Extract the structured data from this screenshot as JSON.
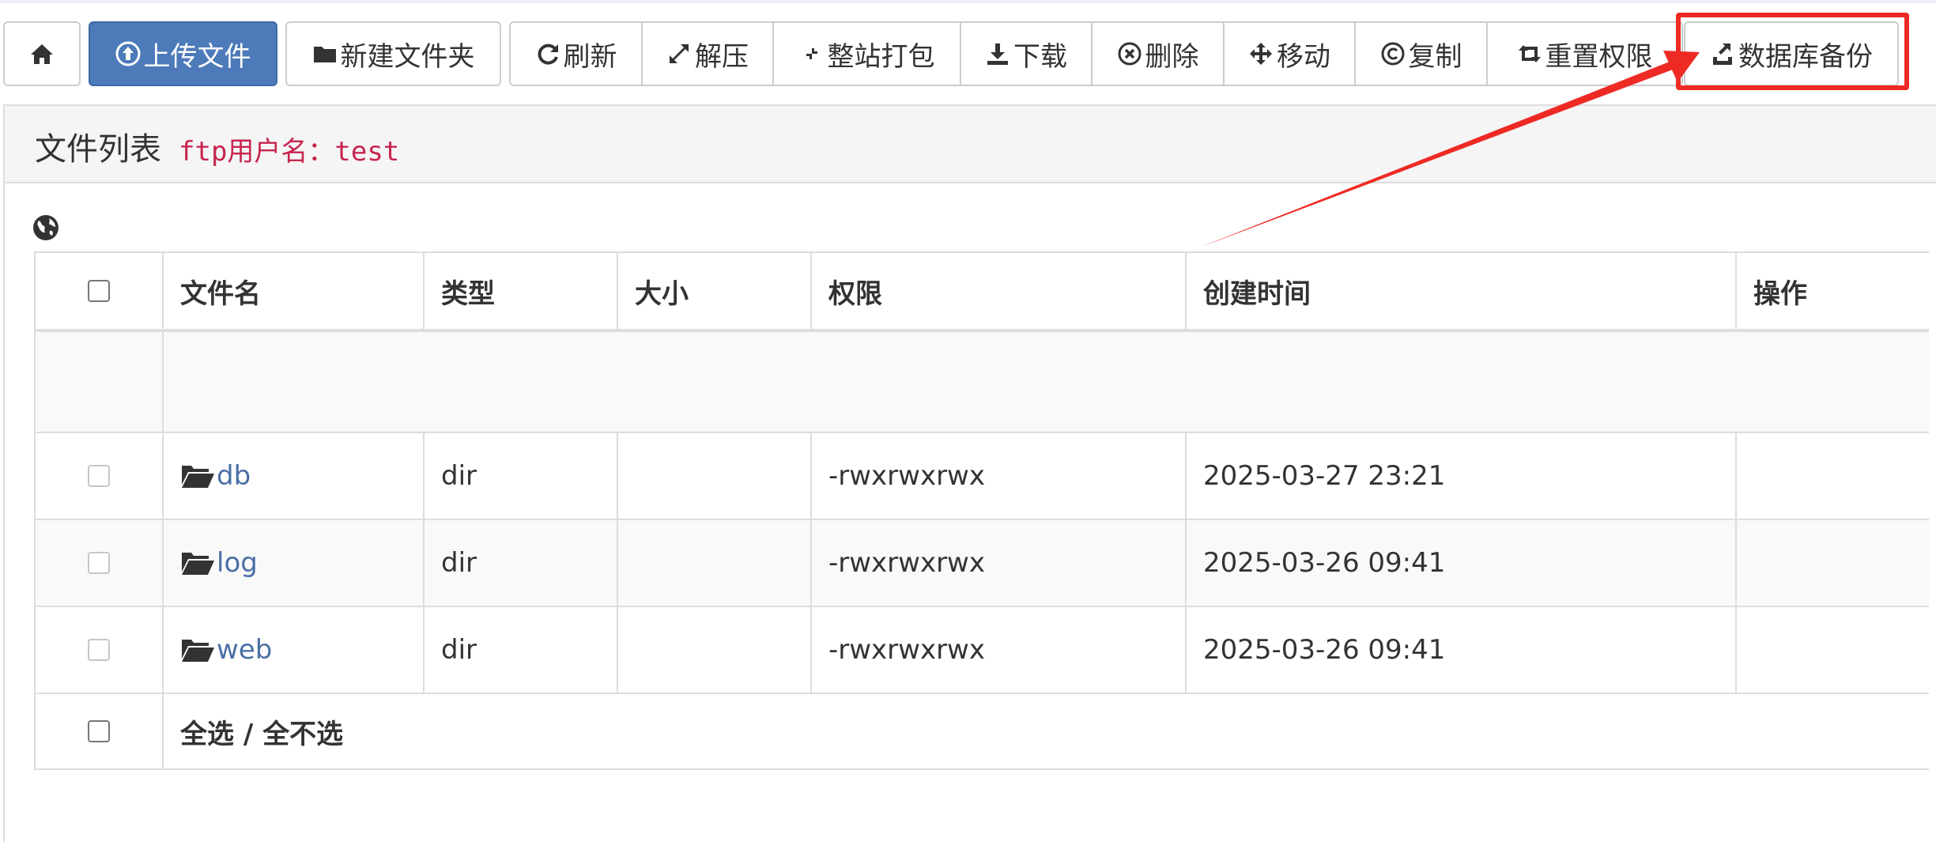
{
  "toolbar": {
    "home_label": "",
    "upload_label": "上传文件",
    "new_folder_label": "新建文件夹",
    "refresh_label": "刷新",
    "extract_label": "解压",
    "pack_label": "整站打包",
    "download_label": "下载",
    "delete_label": "删除",
    "move_label": "移动",
    "copy_label": "复制",
    "reset_perm_label": "重置权限",
    "db_backup_label": "数据库备份"
  },
  "panel": {
    "title": "文件列表",
    "ftp_user": "ftp用户名：test"
  },
  "table": {
    "headers": {
      "name": "文件名",
      "type": "类型",
      "size": "大小",
      "perm": "权限",
      "created": "创建时间",
      "action": "操作"
    },
    "rows": [
      {
        "name": "db",
        "type": "dir",
        "size": "",
        "perm": "-rwxrwxrwx",
        "created": "2025-03-27 23:21",
        "action": ""
      },
      {
        "name": "log",
        "type": "dir",
        "size": "",
        "perm": "-rwxrwxrwx",
        "created": "2025-03-26 09:41",
        "action": ""
      },
      {
        "name": "web",
        "type": "dir",
        "size": "",
        "perm": "-rwxrwxrwx",
        "created": "2025-03-26 09:41",
        "action": ""
      }
    ],
    "select_all_label": "全选 / 全不选"
  },
  "colors": {
    "primary": "#4d7ab9",
    "link": "#4a6fa5",
    "ftp_label": "#c7254e",
    "annotation": "#ee2a24"
  },
  "icons": [
    "home-icon",
    "upload-icon",
    "folder-icon",
    "refresh-icon",
    "expand-icon",
    "compress-icon",
    "download-icon",
    "delete-icon",
    "move-icon",
    "copyright-icon",
    "reset-icon",
    "export-icon",
    "globe-icon"
  ]
}
